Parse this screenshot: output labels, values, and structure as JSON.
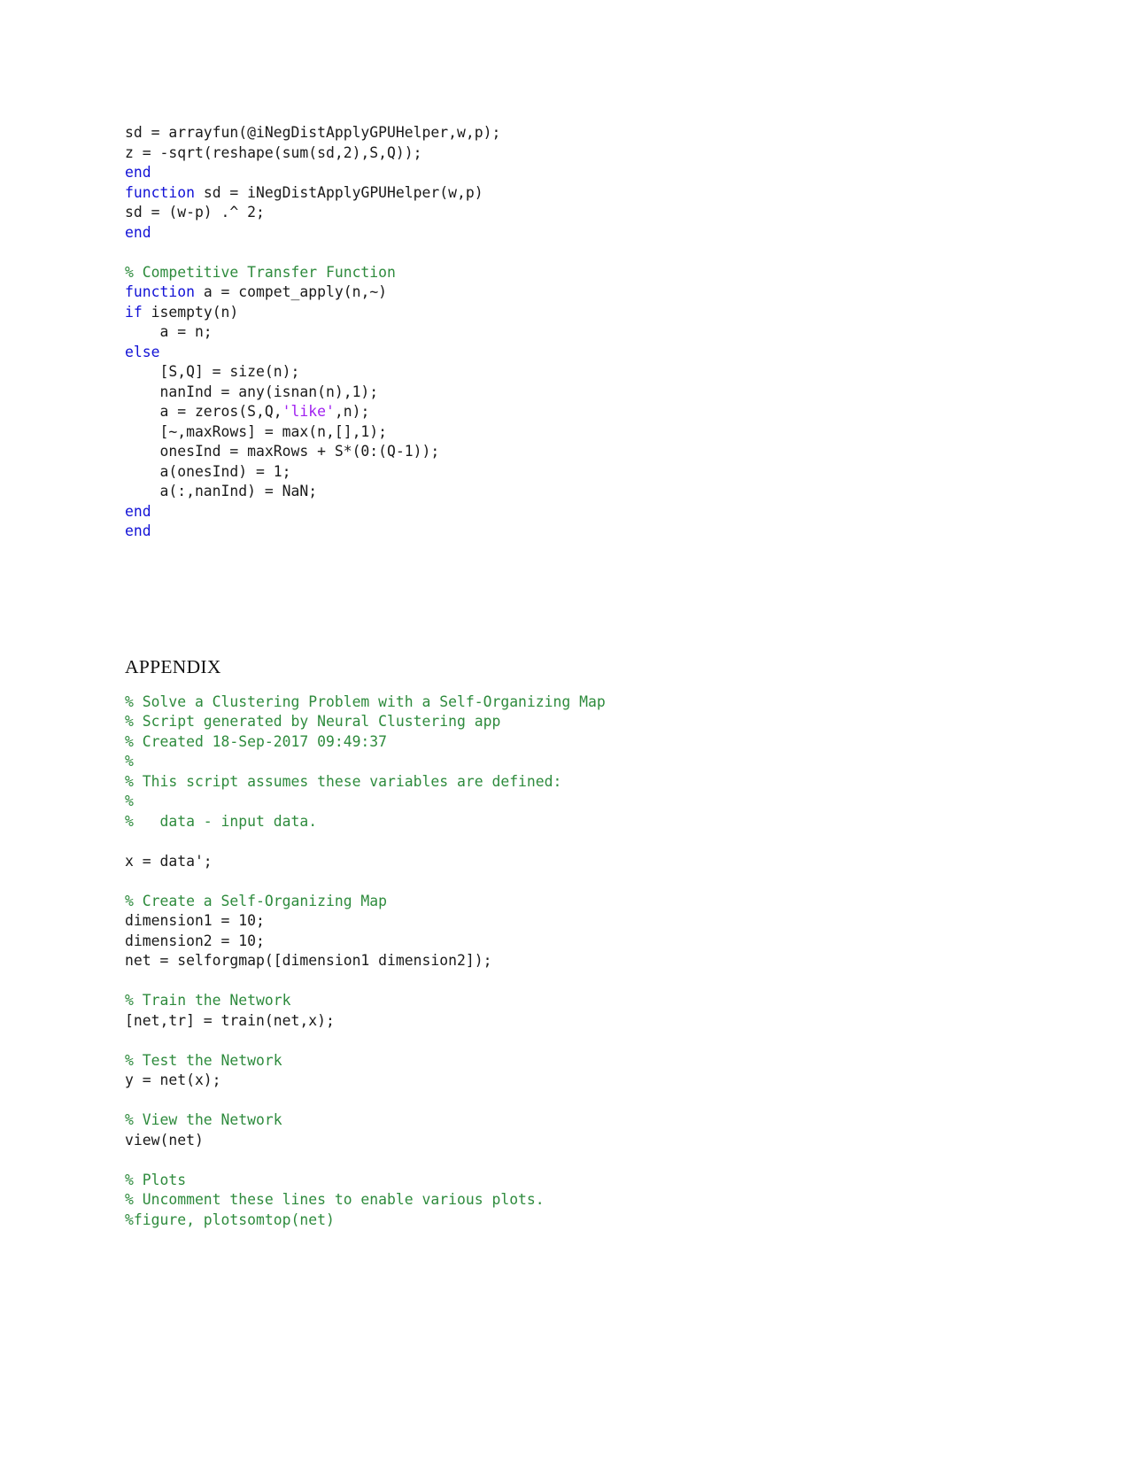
{
  "document": {
    "background_color": "#ffffff",
    "text_color": "#1a1a1a",
    "keyword_color": "#1212d6",
    "comment_color": "#2e8b3d",
    "string_color": "#a020f0"
  },
  "code_block_top": {
    "lines": [
      [
        {
          "t": "sd = arrayfun(@iNegDistApplyGPUHelper,w,p);",
          "c": "plain"
        }
      ],
      [
        {
          "t": "z = -sqrt(reshape(sum(sd,2),S,Q));",
          "c": "plain"
        }
      ],
      [
        {
          "t": "end",
          "c": "kw"
        }
      ],
      [
        {
          "t": "function",
          "c": "kw"
        },
        {
          "t": " sd = iNegDistApplyGPUHelper(w,p)",
          "c": "plain"
        }
      ],
      [
        {
          "t": "sd = (w-p) .^ 2;",
          "c": "plain"
        }
      ],
      [
        {
          "t": "end",
          "c": "kw"
        }
      ],
      [],
      [
        {
          "t": "% Competitive Transfer Function",
          "c": "cmt"
        }
      ],
      [
        {
          "t": "function",
          "c": "kw"
        },
        {
          "t": " a = compet_apply(n,~)",
          "c": "plain"
        }
      ],
      [
        {
          "t": "if",
          "c": "kw"
        },
        {
          "t": " isempty(n)",
          "c": "plain"
        }
      ],
      [
        {
          "t": "    a = n;",
          "c": "plain"
        }
      ],
      [
        {
          "t": "else",
          "c": "kw"
        }
      ],
      [
        {
          "t": "    [S,Q] = size(n);",
          "c": "plain"
        }
      ],
      [
        {
          "t": "    nanInd = any(isnan(n),1);",
          "c": "plain"
        }
      ],
      [
        {
          "t": "    a = zeros(S,Q,",
          "c": "plain"
        },
        {
          "t": "'like'",
          "c": "str"
        },
        {
          "t": ",n);",
          "c": "plain"
        }
      ],
      [
        {
          "t": "    [~,maxRows] = max(n,[],1);",
          "c": "plain"
        }
      ],
      [
        {
          "t": "    onesInd = maxRows + S*(0:(Q-1));",
          "c": "plain"
        }
      ],
      [
        {
          "t": "    a(onesInd) = 1;",
          "c": "plain"
        }
      ],
      [
        {
          "t": "    a(:,nanInd) = NaN;",
          "c": "plain"
        }
      ],
      [
        {
          "t": "end",
          "c": "kw"
        }
      ],
      [
        {
          "t": "end",
          "c": "kw"
        }
      ]
    ]
  },
  "appendix": {
    "heading": "APPENDIX",
    "lines": [
      [
        {
          "t": "% Solve a Clustering Problem with a Self-Organizing Map",
          "c": "cmt"
        }
      ],
      [
        {
          "t": "% Script generated by Neural Clustering app",
          "c": "cmt"
        }
      ],
      [
        {
          "t": "% Created 18-Sep-2017 09:49:37",
          "c": "cmt"
        }
      ],
      [
        {
          "t": "%",
          "c": "cmt"
        }
      ],
      [
        {
          "t": "% This script assumes these variables are defined:",
          "c": "cmt"
        }
      ],
      [
        {
          "t": "%",
          "c": "cmt"
        }
      ],
      [
        {
          "t": "%   data - input data.",
          "c": "cmt"
        }
      ],
      [],
      [
        {
          "t": "x = data';",
          "c": "plain"
        }
      ],
      [],
      [
        {
          "t": "% Create a Self-Organizing Map",
          "c": "cmt"
        }
      ],
      [
        {
          "t": "dimension1 = 10;",
          "c": "plain"
        }
      ],
      [
        {
          "t": "dimension2 = 10;",
          "c": "plain"
        }
      ],
      [
        {
          "t": "net = selforgmap([dimension1 dimension2]);",
          "c": "plain"
        }
      ],
      [],
      [
        {
          "t": "% Train the Network",
          "c": "cmt"
        }
      ],
      [
        {
          "t": "[net,tr] = train(net,x);",
          "c": "plain"
        }
      ],
      [],
      [
        {
          "t": "% Test the Network",
          "c": "cmt"
        }
      ],
      [
        {
          "t": "y = net(x);",
          "c": "plain"
        }
      ],
      [],
      [
        {
          "t": "% View the Network",
          "c": "cmt"
        }
      ],
      [
        {
          "t": "view(net)",
          "c": "plain"
        }
      ],
      [],
      [
        {
          "t": "% Plots",
          "c": "cmt"
        }
      ],
      [
        {
          "t": "% Uncomment these lines to enable various plots.",
          "c": "cmt"
        }
      ],
      [
        {
          "t": "%figure, plotsomtop(net)",
          "c": "cmt"
        }
      ]
    ]
  }
}
